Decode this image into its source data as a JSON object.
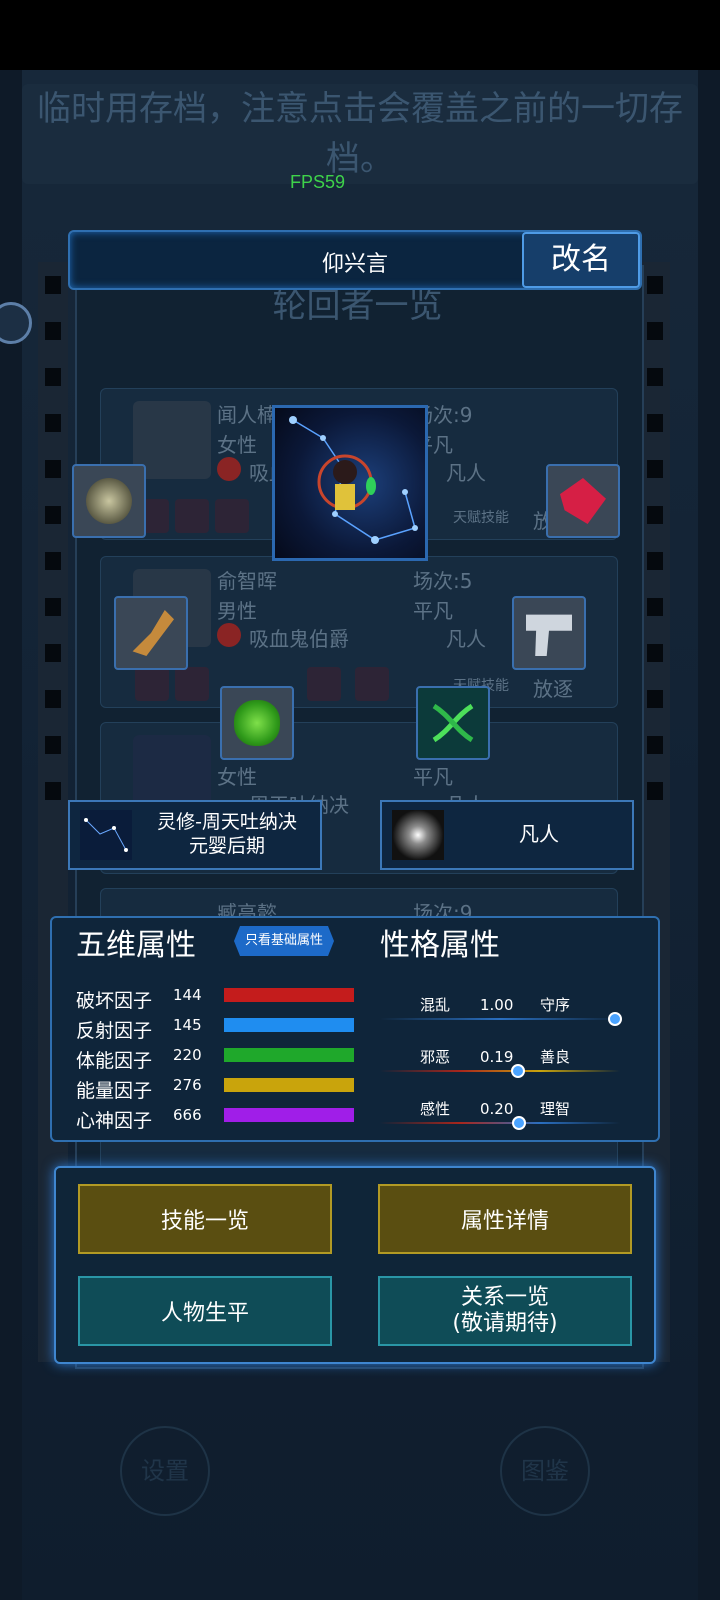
{
  "notice": "临时用存档，注意点击会覆盖之前的一切存档。",
  "fps": "FPS59",
  "header": {
    "name": "仰兴言",
    "rename_label": "改名"
  },
  "list_title": "轮回者一览",
  "background_list": [
    {
      "name": "闻人楠晖",
      "gender": "女性",
      "talent": "吸血",
      "scene": "场次:9",
      "rank": "平凡",
      "rank2": "凡人",
      "skill": "天赋技能",
      "action": "放"
    },
    {
      "name": "俞智晖",
      "gender": "男性",
      "talent": "吸血鬼伯爵",
      "scene": "场次:5",
      "rank": "平凡",
      "rank2": "凡人",
      "skill": "天赋技能",
      "action": "放逐"
    },
    {
      "name": "",
      "gender": "女性",
      "talent": "周天吐纳决",
      "scene": "",
      "rank": "平凡",
      "rank2": "凡人"
    },
    {
      "name": "臧高懿",
      "scene": "场次:9"
    }
  ],
  "character": {
    "cultivation_line1": "灵修-周天吐纳决",
    "cultivation_line2": "元婴后期",
    "race": "凡人"
  },
  "items": [
    "rock-icon",
    "red-crystal-icon",
    "claw-icon",
    "raygun-icon",
    "green-ore-icon",
    "dna-helix-icon"
  ],
  "stats": {
    "five_title": "五维属性",
    "basic_only_label": "只看基础属性",
    "personality_title": "性格属性",
    "five": [
      {
        "label": "破坏因子",
        "value": "144",
        "color": "#c41c1c"
      },
      {
        "label": "反射因子",
        "value": "145",
        "color": "#1f8df0"
      },
      {
        "label": "体能因子",
        "value": "220",
        "color": "#1fa82b"
      },
      {
        "label": "能量因子",
        "value": "276",
        "color": "#c9a40c"
      },
      {
        "label": "心神因子",
        "value": "666",
        "color": "#a01ee8"
      }
    ],
    "personality": [
      {
        "left": "混乱",
        "value": "1.00",
        "right": "守序",
        "fraction": 1.0
      },
      {
        "left": "邪恶",
        "value": "0.19",
        "right": "善良",
        "fraction": 0.595
      },
      {
        "left": "感性",
        "value": "0.20",
        "right": "理智",
        "fraction": 0.6
      }
    ]
  },
  "menu": {
    "skills": "技能一览",
    "attributes": "属性详情",
    "life": "人物生平",
    "relations_line1": "关系一览",
    "relations_line2": "(敬请期待)"
  },
  "bottom": {
    "settings": "设置",
    "gallery": "图鉴"
  },
  "colors": {
    "accent_blue": "#2f6fb0",
    "gold": "#b29a24",
    "teal": "#2a96a6"
  }
}
